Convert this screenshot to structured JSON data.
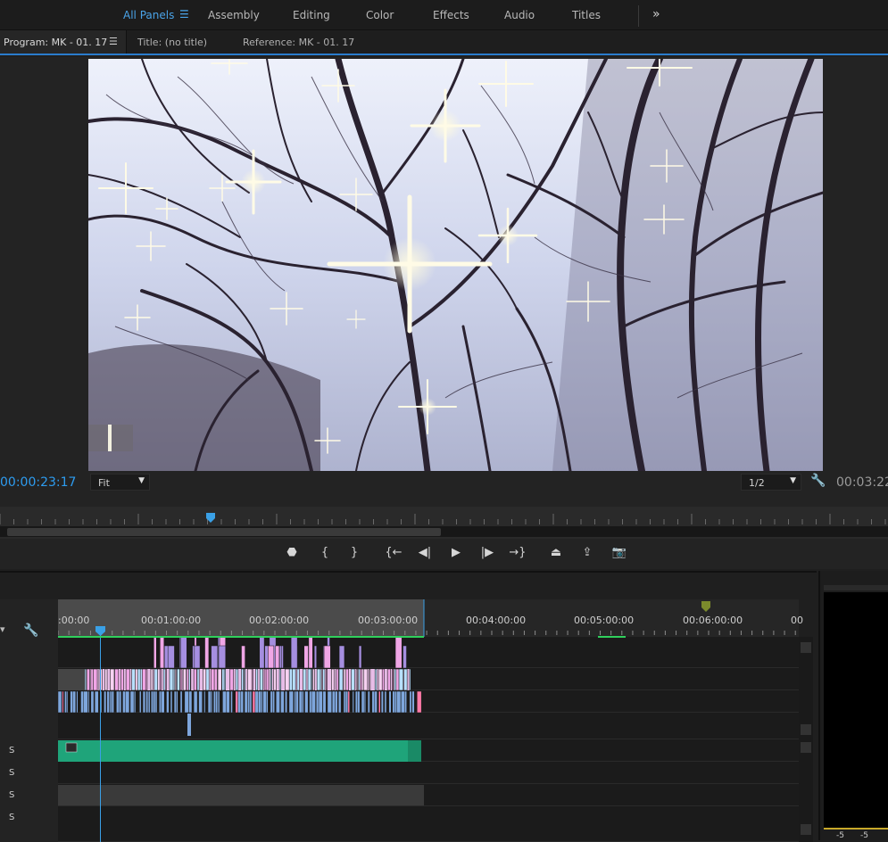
{
  "workspaces": {
    "items": [
      {
        "label": "All Panels",
        "active": true
      },
      {
        "label": "Assembly"
      },
      {
        "label": "Editing"
      },
      {
        "label": "Color"
      },
      {
        "label": "Effects"
      },
      {
        "label": "Audio"
      },
      {
        "label": "Titles"
      }
    ],
    "menu_icon": "hamburger-icon",
    "overflow_icon": "double-chevron-right-icon"
  },
  "tabs": {
    "program": "Program: MK - 01. 17",
    "title": "Title: (no title)",
    "reference": "Reference: MK - 01. 17"
  },
  "monitor": {
    "current_timecode": "00:00:23:17",
    "duration_timecode": "00:03:22",
    "zoom": "Fit",
    "resolution": "1/2",
    "playhead_fraction": 0.237
  },
  "transport": [
    {
      "name": "add-marker-button",
      "glyph": "⬣"
    },
    {
      "name": "mark-in-button",
      "glyph": "{"
    },
    {
      "name": "mark-out-button",
      "glyph": "}"
    },
    {
      "name": "go-to-in-button",
      "glyph": "{←"
    },
    {
      "name": "step-back-button",
      "glyph": "◀|"
    },
    {
      "name": "play-button",
      "glyph": "▶"
    },
    {
      "name": "step-forward-button",
      "glyph": "|▶"
    },
    {
      "name": "go-to-out-button",
      "glyph": "→}"
    },
    {
      "name": "lift-button",
      "glyph": "⏏"
    },
    {
      "name": "extract-button",
      "glyph": "⇪"
    },
    {
      "name": "export-frame-button",
      "glyph": "📷"
    }
  ],
  "timeline": {
    "ruler_labels": [
      ":00:00",
      "00:01:00:00",
      "00:02:00:00",
      "00:03:00:00",
      "00:04:00:00",
      "00:05:00:00",
      "00:06:00:00",
      "00"
    ],
    "track_labels": [
      "S",
      "S",
      "S",
      "S"
    ]
  },
  "meter": {
    "labels": [
      "-5",
      "-5"
    ]
  },
  "colors": {
    "accent": "#2d9cf0",
    "clip_green": "#1fa47a",
    "clip_pink": "#f0a6e6",
    "clip_blue": "#7ea6dc",
    "clip_violet": "#a58ee0"
  }
}
